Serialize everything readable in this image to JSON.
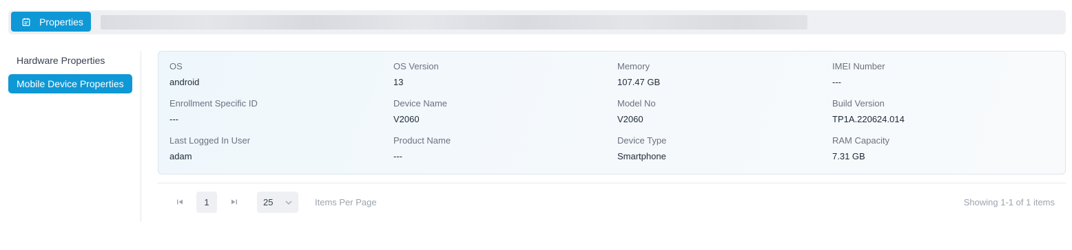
{
  "header": {
    "properties_button_label": "Properties",
    "properties_icon": "calendar-clipboard-icon",
    "accent_color": "#0f98d6"
  },
  "sidebar": {
    "items": [
      {
        "label": "Hardware Properties",
        "active": false
      },
      {
        "label": "Mobile Device Properties",
        "active": true
      }
    ]
  },
  "properties": {
    "rows": [
      [
        {
          "label": "OS",
          "value": "android"
        },
        {
          "label": "OS Version",
          "value": "13"
        },
        {
          "label": "Memory",
          "value": "107.47 GB"
        },
        {
          "label": "IMEI Number",
          "value": "---"
        }
      ],
      [
        {
          "label": "Enrollment Specific ID",
          "value": "---"
        },
        {
          "label": "Device Name",
          "value": "V2060"
        },
        {
          "label": "Model No",
          "value": "V2060"
        },
        {
          "label": "Build Version",
          "value": "TP1A.220624.014"
        }
      ],
      [
        {
          "label": "Last Logged In User",
          "value": "adam"
        },
        {
          "label": "Product Name",
          "value": "---"
        },
        {
          "label": "Device Type",
          "value": "Smartphone"
        },
        {
          "label": "RAM Capacity",
          "value": "7.31 GB"
        }
      ]
    ]
  },
  "pagination": {
    "first_icon": "first-page-icon",
    "last_icon": "last-page-icon",
    "current_page": "1",
    "page_size": "25",
    "page_size_icon": "chevron-down-icon",
    "items_per_page_label": "Items Per Page",
    "status": "Showing 1-1 of 1 items"
  }
}
